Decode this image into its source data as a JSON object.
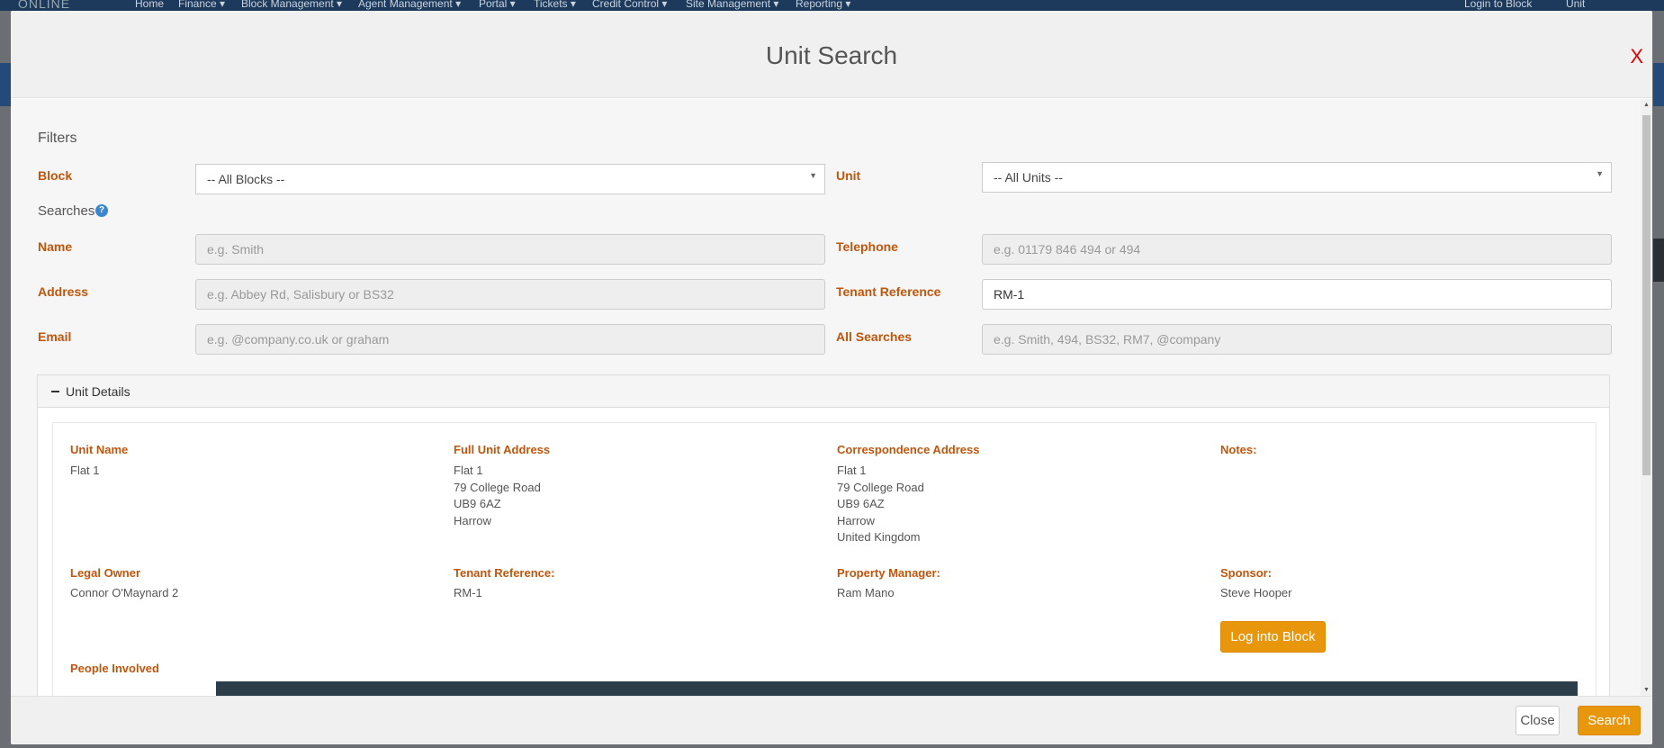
{
  "background_nav": {
    "logo": "ONLINE",
    "items": [
      "Home",
      "Finance ▾",
      "Block Management ▾",
      "Agent Management ▾",
      "Portal ▾",
      "Tickets ▾",
      "Credit Control ▾",
      "Site Management ▾",
      "Reporting ▾"
    ],
    "right_items": [
      "Login to Block",
      "Unit"
    ]
  },
  "modal": {
    "title": "Unit Search",
    "close_x": "X"
  },
  "filters": {
    "heading": "Filters",
    "block_label": "Block",
    "block_value": "-- All Blocks --",
    "unit_label": "Unit",
    "unit_value": "-- All Units --"
  },
  "searches": {
    "heading": "Searches",
    "help": "?",
    "name_label": "Name",
    "name_placeholder": "e.g. Smith",
    "telephone_label": "Telephone",
    "telephone_placeholder": "e.g. 01179 846 494 or 494",
    "address_label": "Address",
    "address_placeholder": "e.g. Abbey Rd, Salisbury or BS32",
    "tenant_ref_label": "Tenant Reference",
    "tenant_ref_value": "RM-1",
    "email_label": "Email",
    "email_placeholder": "e.g. @company.co.uk or graham",
    "all_searches_label": "All Searches",
    "all_searches_placeholder": "e.g. Smith, 494, BS32, RM7, @company"
  },
  "unit_details": {
    "heading": "Unit Details",
    "unit_name_label": "Unit Name",
    "unit_name": "Flat 1",
    "full_address_label": "Full Unit Address",
    "full_address": [
      "Flat 1",
      "79 College Road",
      "UB9 6AZ",
      "Harrow"
    ],
    "corr_address_label": "Correspondence Address",
    "corr_address": [
      "Flat 1",
      "79 College Road",
      "UB9 6AZ",
      "Harrow",
      "United Kingdom"
    ],
    "notes_label": "Notes:",
    "legal_owner_label": "Legal Owner",
    "legal_owner": "Connor O'Maynard 2",
    "tenant_ref_label": "Tenant Reference:",
    "tenant_ref": "RM-1",
    "property_manager_label": "Property Manager:",
    "property_manager": "Ram Mano",
    "sponsor_label": "Sponsor:",
    "sponsor": "Steve Hooper",
    "log_into_block": "Log into Block",
    "people_involved_label": "People Involved"
  },
  "footer": {
    "close": "Close",
    "search": "Search"
  },
  "colors": {
    "accent_orange": "#e8960c",
    "label_orange": "#c0560c",
    "close_red": "#e00000"
  }
}
